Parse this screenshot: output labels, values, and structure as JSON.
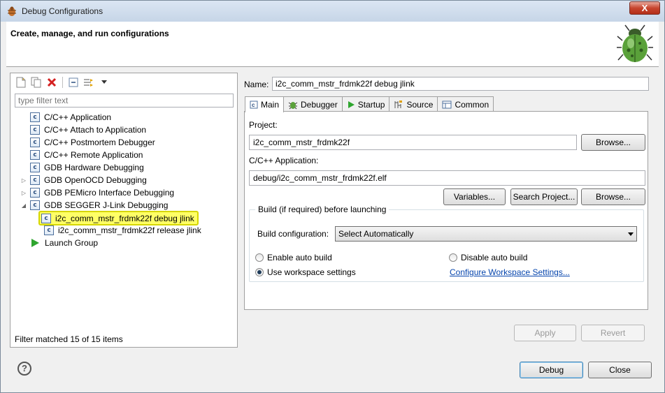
{
  "window": {
    "title": "Debug Configurations",
    "close_label": "X"
  },
  "banner": {
    "title": "Create, manage, and run configurations"
  },
  "left": {
    "filter_placeholder": "type filter text",
    "tree": [
      {
        "label": "C/C++ Application",
        "icon": "c-config-icon",
        "expander": ""
      },
      {
        "label": "C/C++ Attach to Application",
        "icon": "c-config-icon",
        "expander": ""
      },
      {
        "label": "C/C++ Postmortem Debugger",
        "icon": "c-config-icon",
        "expander": ""
      },
      {
        "label": "C/C++ Remote Application",
        "icon": "c-config-icon",
        "expander": ""
      },
      {
        "label": "GDB Hardware Debugging",
        "icon": "c-config-icon",
        "expander": ""
      },
      {
        "label": "GDB OpenOCD Debugging",
        "icon": "c-config-icon",
        "expander": "collapsed"
      },
      {
        "label": "GDB PEMicro Interface Debugging",
        "icon": "c-config-icon",
        "expander": "collapsed"
      },
      {
        "label": "GDB SEGGER J-Link Debugging",
        "icon": "c-config-icon",
        "expander": "expanded"
      },
      {
        "label": "i2c_comm_mstr_frdmk22f debug jlink",
        "icon": "c-config-icon",
        "expander": "",
        "child": true,
        "selected": true
      },
      {
        "label": "i2c_comm_mstr_frdmk22f release jlink",
        "icon": "c-config-icon",
        "expander": "",
        "child": true
      },
      {
        "label": "Launch Group",
        "icon": "launch-group-icon",
        "expander": ""
      }
    ],
    "status": "Filter matched 15 of 15 items"
  },
  "right": {
    "name_label": "Name:",
    "name_value": "i2c_comm_mstr_frdmk22f debug jlink",
    "tabs": [
      {
        "label": "Main",
        "icon": "main-tab-icon",
        "active": true
      },
      {
        "label": "Debugger",
        "icon": "debugger-tab-icon"
      },
      {
        "label": "Startup",
        "icon": "startup-tab-icon"
      },
      {
        "label": "Source",
        "icon": "source-tab-icon"
      },
      {
        "label": "Common",
        "icon": "common-tab-icon"
      }
    ],
    "project_label": "Project:",
    "project_value": "i2c_comm_mstr_frdmk22f",
    "browse_label": "Browse...",
    "app_label": "C/C++ Application:",
    "app_value": "debug/i2c_comm_mstr_frdmk22f.elf",
    "variables_label": "Variables...",
    "search_project_label": "Search Project...",
    "browse2_label": "Browse...",
    "build_group_title": "Build (if required) before launching",
    "build_config_label": "Build configuration:",
    "build_config_value": "Select Automatically",
    "enable_auto_build": "Enable auto build",
    "disable_auto_build": "Disable auto build",
    "use_workspace": "Use workspace settings",
    "configure_workspace": "Configure Workspace Settings...",
    "radio_selected": "use_workspace",
    "apply_label": "Apply",
    "revert_label": "Revert"
  },
  "footer": {
    "help_label": "?",
    "debug_label": "Debug",
    "close_label": "Close"
  },
  "colors": {
    "selection_highlight": "#ffff66",
    "link": "#0645ad",
    "launch_green": "#2ea52e"
  }
}
